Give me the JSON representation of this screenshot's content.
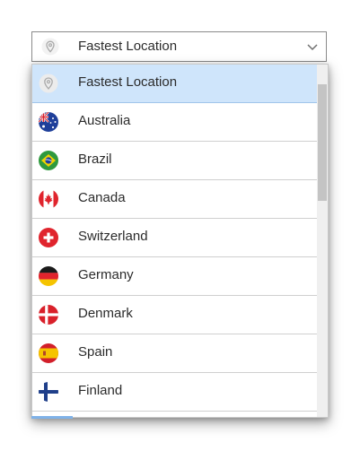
{
  "combobox": {
    "selected_label": "Fastest Location",
    "icon": "location-pin-icon",
    "arrow_icon": "chevron-down-icon"
  },
  "dropdown": {
    "items": [
      {
        "label": "Fastest Location",
        "icon": "location-pin-icon",
        "selected": true
      },
      {
        "label": "Australia",
        "icon": "australia-flag-icon"
      },
      {
        "label": "Brazil",
        "icon": "brazil-flag-icon"
      },
      {
        "label": "Canada",
        "icon": "canada-flag-icon"
      },
      {
        "label": "Switzerland",
        "icon": "switzerland-flag-icon"
      },
      {
        "label": "Germany",
        "icon": "germany-flag-icon"
      },
      {
        "label": "Denmark",
        "icon": "denmark-flag-icon"
      },
      {
        "label": "Spain",
        "icon": "spain-flag-icon"
      },
      {
        "label": "Finland",
        "icon": "finland-flag-icon"
      }
    ]
  },
  "colors": {
    "selected_background": "#cfe5fb",
    "border": "#8a8a8a",
    "text": "#2b2b2b"
  }
}
